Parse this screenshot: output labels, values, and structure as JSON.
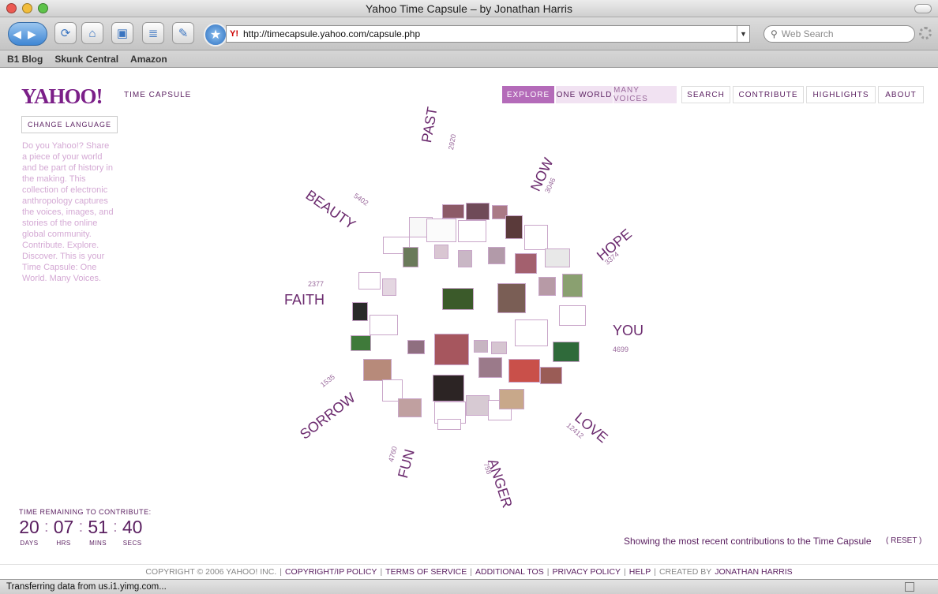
{
  "window": {
    "title": "Yahoo Time Capsule – by Jonathan Harris"
  },
  "toolbar": {
    "url": "http://timecapsule.yahoo.com/capsule.php",
    "search_placeholder": "Web Search",
    "url_prefix": "Y!"
  },
  "bookmarks": [
    "B1 Blog",
    "Skunk Central",
    "Amazon"
  ],
  "page": {
    "logo": "YAHOO!",
    "logo_sub": "TIME CAPSULE",
    "change_language": "CHANGE LANGUAGE",
    "intro": "Do you Yahoo!? Share a piece of your world and be part of history in the making. This collection of electronic anthropology captures the voices, images, and stories of the online global community. Contribute. Explore. Discover. This is your Time Capsule: One World. Many Voices.",
    "nav": {
      "explore": "EXPLORE",
      "one_world": "ONE WORLD",
      "many_voices": "MANY VOICES",
      "search": "SEARCH",
      "contribute": "CONTRIBUTE",
      "highlights": "HIGHLIGHTS",
      "about": "ABOUT"
    },
    "categories": {
      "past": {
        "label": "PAST",
        "count": "2920"
      },
      "now": {
        "label": "NOW",
        "count": "3046"
      },
      "hope": {
        "label": "HOPE",
        "count": "3374"
      },
      "you": {
        "label": "YOU",
        "count": "4699"
      },
      "love": {
        "label": "LOVE",
        "count": "12412"
      },
      "anger": {
        "label": "ANGER",
        "count": "758"
      },
      "fun": {
        "label": "FUN",
        "count": "4760"
      },
      "sorrow": {
        "label": "SORROW",
        "count": "1535"
      },
      "faith": {
        "label": "FAITH",
        "count": "2377"
      },
      "beauty": {
        "label": "BEAUTY",
        "count": "5402"
      }
    },
    "timer": {
      "title": "TIME REMAINING TO CONTRIBUTE:",
      "days": "20",
      "hrs": "07",
      "mins": "51",
      "secs": "40",
      "days_label": "DAYS",
      "hrs_label": "HRS",
      "mins_label": "MINS",
      "secs_label": "SECS"
    },
    "recent_text": "Showing the most recent contributions to the Time Capsule",
    "reset": "( RESET )",
    "footer": {
      "copyright": "COPYRIGHT © 2006 YAHOO! INC.",
      "ip_policy": "COPYRIGHT/IP POLICY",
      "tos": "TERMS OF SERVICE",
      "additional_tos": "ADDITIONAL TOS",
      "privacy": "PRIVACY POLICY",
      "help": "HELP",
      "created_by": "CREATED BY",
      "author": "JONATHAN HARRIS"
    }
  },
  "statusbar": {
    "text": "Transferring data from us.i1.yimg.com..."
  },
  "colors": {
    "accent": "#6b2a6e",
    "nav_active": "#b46bb9",
    "intro": "#d4a9d4"
  }
}
